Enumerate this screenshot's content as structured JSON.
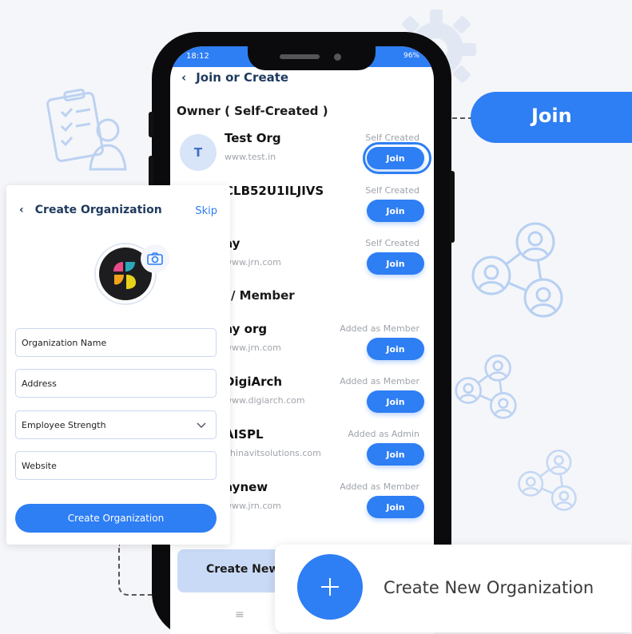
{
  "status_bar": {
    "time": "18:12",
    "battery": "96%"
  },
  "screen": {
    "title": "Join or Create",
    "owner_section": "Owner ( Self-Created )",
    "member_section": "s Admin/ Member",
    "orgs": [
      {
        "avatar": "T",
        "name": "Test Org",
        "url": "www.test.in",
        "role": "Self Created",
        "join": "Join"
      },
      {
        "name": "CLB52U1ILJIVS",
        "url": "",
        "role": "Self Created",
        "join": "Join"
      },
      {
        "name": "ay",
        "url": "www.jrn.com",
        "role": "Self Created",
        "join": "Join"
      },
      {
        "name": "ay org",
        "url": "www.jrn.com",
        "role": "Added as Member",
        "join": "Join"
      },
      {
        "name": "DigiArch",
        "url": "www.digiarch.com",
        "role": "Added as Member",
        "join": "Join"
      },
      {
        "name": "AISPL",
        "url": "bhinavitsolutions.com",
        "role": "Added as Admin",
        "join": "Join"
      },
      {
        "name": "aynew",
        "url": "www.jrn.com",
        "role": "Added as Member",
        "join": "Join"
      }
    ],
    "create_new_button": "Create New"
  },
  "join_callout": "Join",
  "create_panel": {
    "title": "Create Organization",
    "skip": "Skip",
    "fields": {
      "name_placeholder": "Organization Name",
      "address_placeholder": "Address",
      "strength_label": "Employee Strength",
      "website_placeholder": "Website"
    },
    "submit": "Create Organization"
  },
  "new_card": {
    "label": "Create New Organization"
  },
  "colors": {
    "accent": "#2e7ef4",
    "title": "#1f3a5f",
    "deco": "#bcd2f2"
  }
}
